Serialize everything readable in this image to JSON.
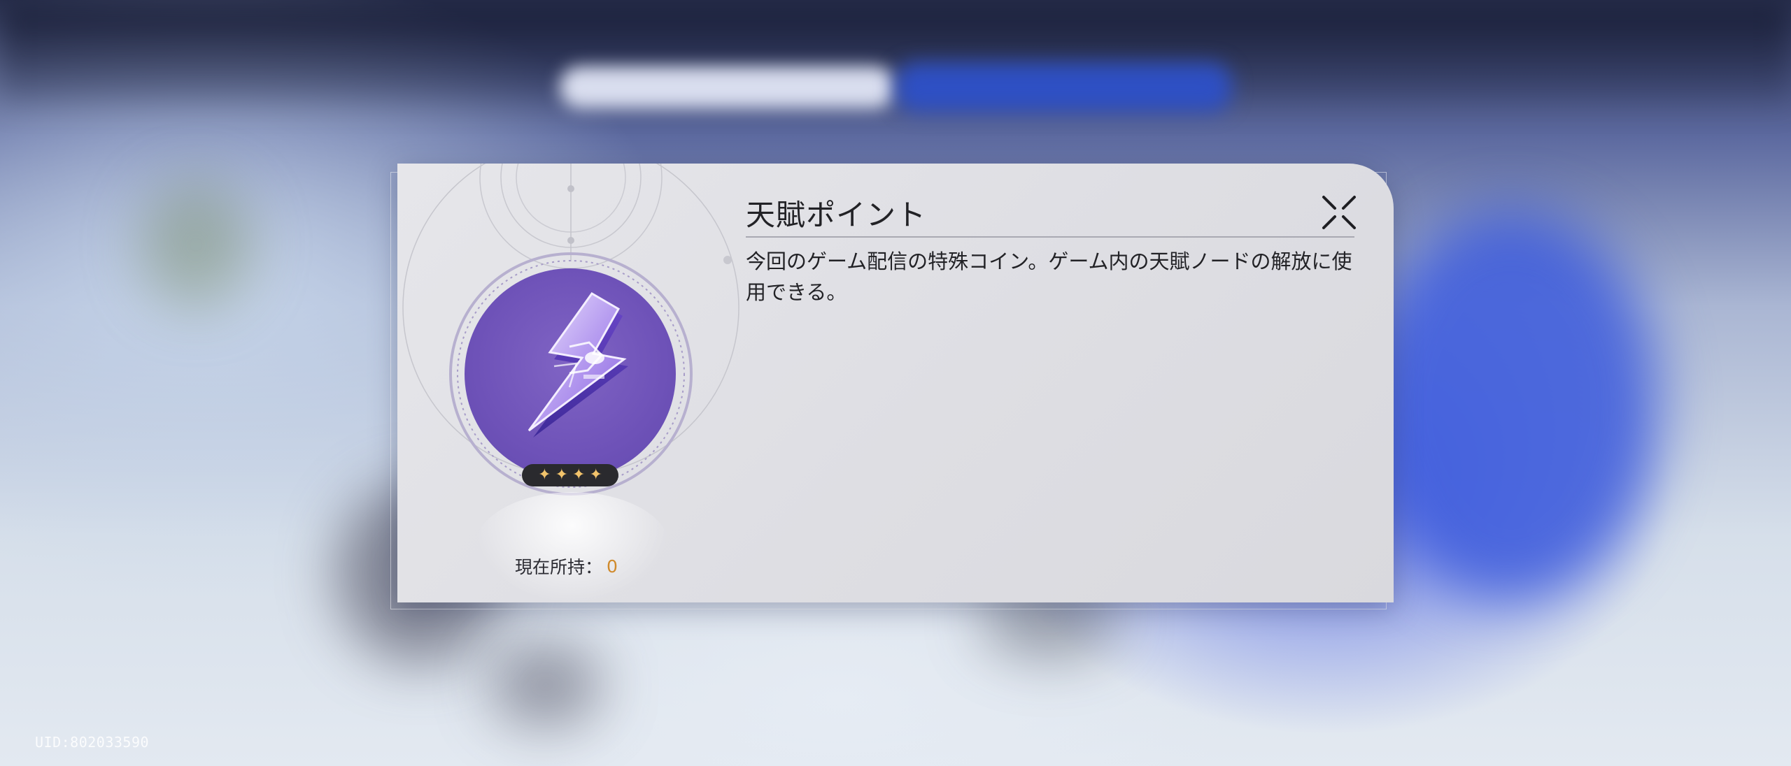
{
  "dialog": {
    "title": "天賦ポイント",
    "description": "今回のゲーム配信の特殊コイン。ゲーム内の天賦ノードの解放に使用できる。",
    "holding_label": "現在所持：",
    "holding_value": "0",
    "rarity_stars": 4,
    "close_icon": "close-x-icon",
    "item_icon": "lightning-chip-icon"
  },
  "footer": {
    "uid": "UID:802033590"
  },
  "colors": {
    "item_circle": "#6e52b8",
    "rarity_star": "#f2c36b",
    "holding_value": "#d08a2c",
    "dialog_bg": "#e0e0e4"
  }
}
